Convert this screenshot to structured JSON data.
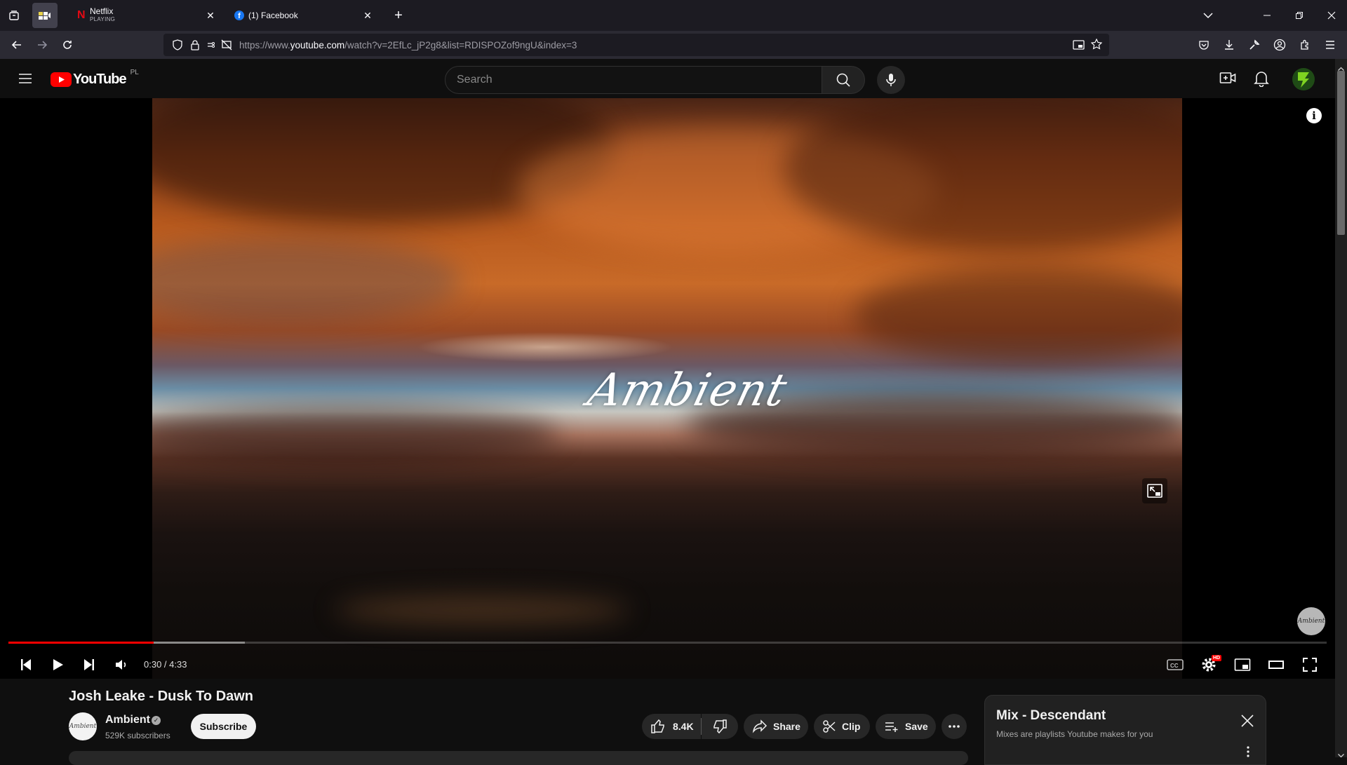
{
  "browser": {
    "tabs": [
      {
        "title": "Netflix",
        "subtitle": "PLAYING"
      },
      {
        "title": "(1) Facebook"
      }
    ],
    "url": {
      "prefix": "https://www.",
      "domain": "youtube.com",
      "path": "/watch?v=2EfLc_jP2g8&list=RDISPOZof9ngU&index=3"
    }
  },
  "youtube": {
    "logo_text": "YouTube",
    "region": "PL",
    "search_placeholder": "Search"
  },
  "player": {
    "watermark": "Ambient",
    "current_time": "0:30",
    "duration": "4:33",
    "time_display": "0:30 / 4:33",
    "played_fraction": 0.1099,
    "loaded_fraction": 0.1791,
    "settings_badge": "HD",
    "channel_watermark": "Ambient"
  },
  "video": {
    "title": "Josh Leake - Dusk To Dawn",
    "channel": "Ambient",
    "subscribers": "529K subscribers",
    "subscribe_label": "Subscribe",
    "likes": "8.4K",
    "share_label": "Share",
    "clip_label": "Clip",
    "save_label": "Save"
  },
  "mix": {
    "title": "Mix - Descendant",
    "subtitle": "Mixes are playlists Youtube makes for you"
  },
  "colors": {
    "accent_red": "#ff0000",
    "background": "#0f0f0f",
    "chrome_dark": "#1c1b22",
    "chrome_toolbar": "#2b2a33"
  }
}
